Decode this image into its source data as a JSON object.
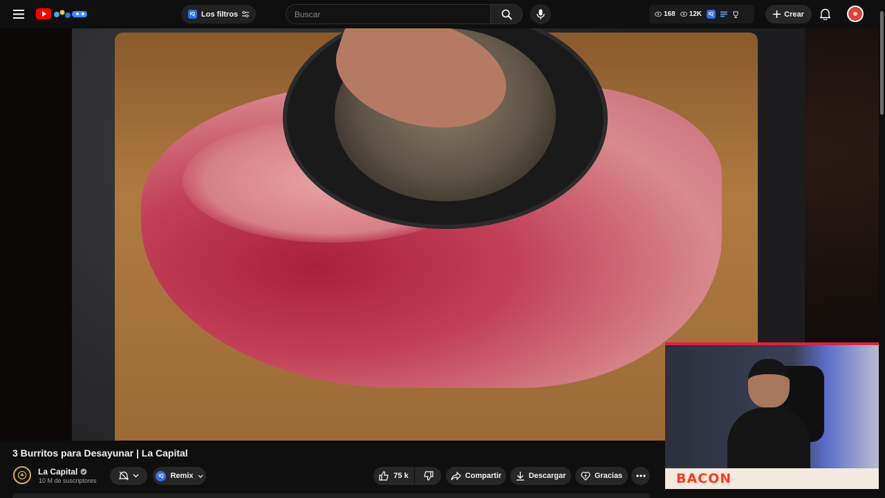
{
  "header": {
    "filter_chip_label": "Los filtros",
    "filter_chip_badge": "IQ",
    "search_placeholder": "Buscar",
    "stats": {
      "viewers": "168",
      "views": "12K",
      "badge": "IQ"
    },
    "create_label": "Crear"
  },
  "video": {
    "title": "3 Burritos para Desayunar | La Capital",
    "overlay_text": "BACON"
  },
  "channel": {
    "name": "La Capital",
    "subscribers": "10 M de suscriptores"
  },
  "actions": {
    "remix_badge": "IQ",
    "remix_label": "Remix",
    "likes": "75 k",
    "share_label": "Compartir",
    "download_label": "Descargar",
    "thanks_label": "Gracias"
  },
  "colors": {
    "accent_red": "#ff0000",
    "live_border": "#e02244",
    "badge_blue": "#2f6fe3"
  }
}
